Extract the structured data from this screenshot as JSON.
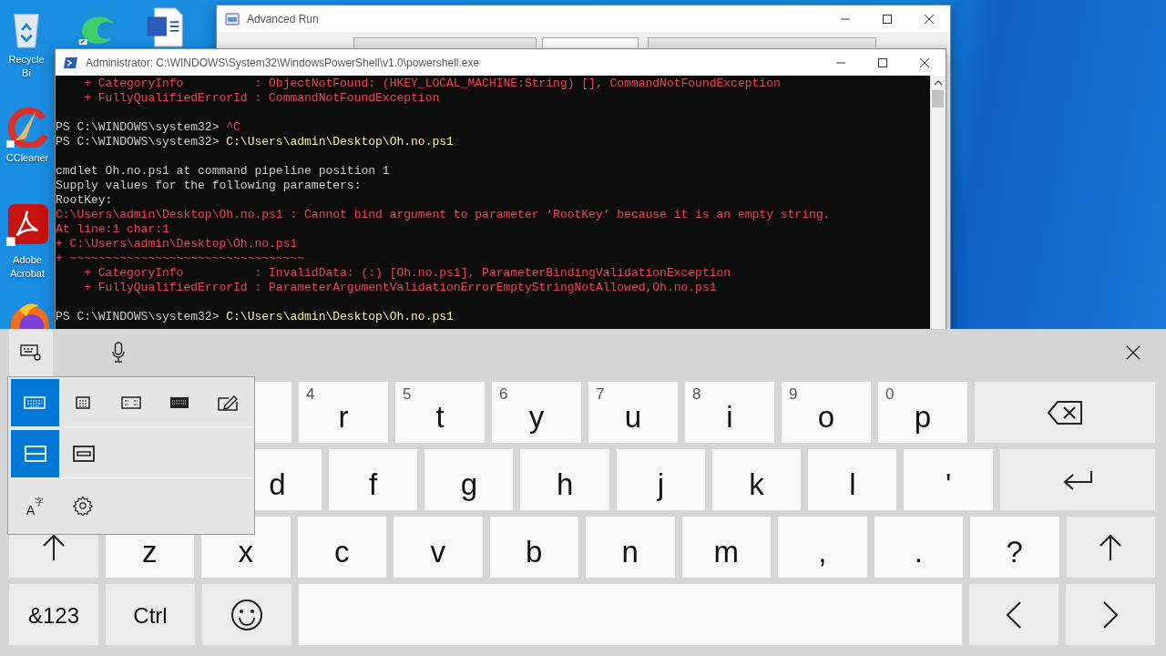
{
  "desktop_icons": [
    {
      "kind": "recycle-bin",
      "label": "Recycle Bi"
    },
    {
      "kind": "edge"
    },
    {
      "kind": "word"
    },
    {
      "kind": "ccleaner",
      "label": "CCleaner"
    },
    {
      "kind": "acrobat",
      "label": "Adobe Acrobat"
    },
    {
      "kind": "firefox"
    }
  ],
  "advanced_run": {
    "title": "Advanced Run"
  },
  "powershell": {
    "title": "Administrator: C:\\WINDOWS\\System32\\WindowsPowerShell\\v1.0\\powershell.exe",
    "blocks": [
      [
        [
          {
            "kind": "error",
            "text": "    + CategoryInfo          : ObjectNotFound: (HKEY_LOCAL_MACHINE:String) [], CommandNotFoundException"
          }
        ],
        [
          {
            "kind": "error",
            "text": "    + FullyQualifiedErrorId : CommandNotFoundException"
          }
        ]
      ],
      [
        [
          {
            "kind": "output",
            "text": "PS C:\\WINDOWS\\system32> "
          },
          {
            "kind": "error",
            "text": "^C"
          }
        ],
        [
          {
            "kind": "output",
            "text": "PS C:\\WINDOWS\\system32> "
          },
          {
            "kind": "command",
            "text": "C:\\Users\\admin\\Desktop\\Oh.no.ps1"
          }
        ]
      ],
      [
        [
          {
            "kind": "output",
            "text": "cmdlet Oh.no.ps1 at command pipeline position 1"
          }
        ],
        [
          {
            "kind": "output",
            "text": "Supply values for the following parameters:"
          }
        ],
        [
          {
            "kind": "output",
            "text": "RootKey:"
          }
        ],
        [
          {
            "kind": "error",
            "text": "C:\\Users\\admin\\Desktop\\Oh.no.ps1 : Cannot bind argument to parameter ‘RootKey’ because it is an empty string."
          }
        ],
        [
          {
            "kind": "error",
            "text": "At line:1 char:1"
          }
        ],
        [
          {
            "kind": "error",
            "text": "+ C:\\Users\\admin\\Desktop\\Oh.no.ps1"
          }
        ],
        [
          {
            "kind": "error",
            "text": "+ ~~~~~~~~~~~~~~~~~~~~~~~~~~~~~~~~~"
          }
        ],
        [
          {
            "kind": "error",
            "text": "    + CategoryInfo          : InvalidData: (:) [Oh.no.ps1], ParameterBindingValidationException"
          }
        ],
        [
          {
            "kind": "error",
            "text": "    + FullyQualifiedErrorId : ParameterArgumentValidationErrorEmptyStringNotAllowed,Oh.no.ps1"
          }
        ]
      ],
      [
        [
          {
            "kind": "output",
            "text": "PS C:\\WINDOWS\\system32> "
          },
          {
            "kind": "command",
            "text": "C:\\Users\\admin\\Desktop\\Oh.no.ps1"
          }
        ]
      ]
    ]
  },
  "keyboard": {
    "flyout": {
      "layouts": [
        {
          "kind": "default",
          "selected": true
        },
        {
          "kind": "small",
          "selected": false
        },
        {
          "kind": "split",
          "selected": false
        },
        {
          "kind": "full",
          "selected": false
        },
        {
          "kind": "handwriting",
          "selected": false
        }
      ],
      "docking": [
        {
          "kind": "docked",
          "selected": true
        },
        {
          "kind": "undocked",
          "selected": false
        }
      ],
      "language_glyph": "A字"
    },
    "rows": [
      [
        {
          "kind": "char"
        },
        {
          "kind": "char"
        },
        {
          "kind": "char"
        },
        {
          "kind": "char",
          "hint": "4",
          "label": "r"
        },
        {
          "kind": "char",
          "hint": "5",
          "label": "t"
        },
        {
          "kind": "char",
          "hint": "6",
          "label": "y"
        },
        {
          "kind": "char",
          "hint": "7",
          "label": "u"
        },
        {
          "kind": "char",
          "hint": "8",
          "label": "i"
        },
        {
          "kind": "char",
          "hint": "9",
          "label": "o"
        },
        {
          "kind": "char",
          "hint": "0",
          "label": "p"
        },
        {
          "kind": "backspace"
        }
      ],
      [
        {
          "kind": "indent"
        },
        {
          "kind": "char"
        },
        {
          "kind": "char"
        },
        {
          "kind": "char",
          "label": "d"
        },
        {
          "kind": "char",
          "label": "f"
        },
        {
          "kind": "char",
          "label": "g"
        },
        {
          "kind": "char",
          "label": "h"
        },
        {
          "kind": "char",
          "label": "j"
        },
        {
          "kind": "char",
          "label": "k"
        },
        {
          "kind": "char",
          "label": "l"
        },
        {
          "kind": "char",
          "label": "'"
        },
        {
          "kind": "enter"
        }
      ],
      [
        {
          "kind": "shift"
        },
        {
          "kind": "char",
          "label": "z"
        },
        {
          "kind": "char",
          "label": "x"
        },
        {
          "kind": "char",
          "label": "c"
        },
        {
          "kind": "char",
          "label": "v"
        },
        {
          "kind": "char",
          "label": "b"
        },
        {
          "kind": "char",
          "label": "n"
        },
        {
          "kind": "char",
          "label": "m"
        },
        {
          "kind": "char",
          "label": ","
        },
        {
          "kind": "char",
          "label": "."
        },
        {
          "kind": "char",
          "label": "?"
        },
        {
          "kind": "shift"
        }
      ],
      [
        {
          "kind": "label",
          "label": "&123"
        },
        {
          "kind": "label",
          "label": "Ctrl"
        },
        {
          "kind": "emoji"
        },
        {
          "kind": "space"
        },
        {
          "kind": "left"
        },
        {
          "kind": "right"
        }
      ]
    ]
  }
}
